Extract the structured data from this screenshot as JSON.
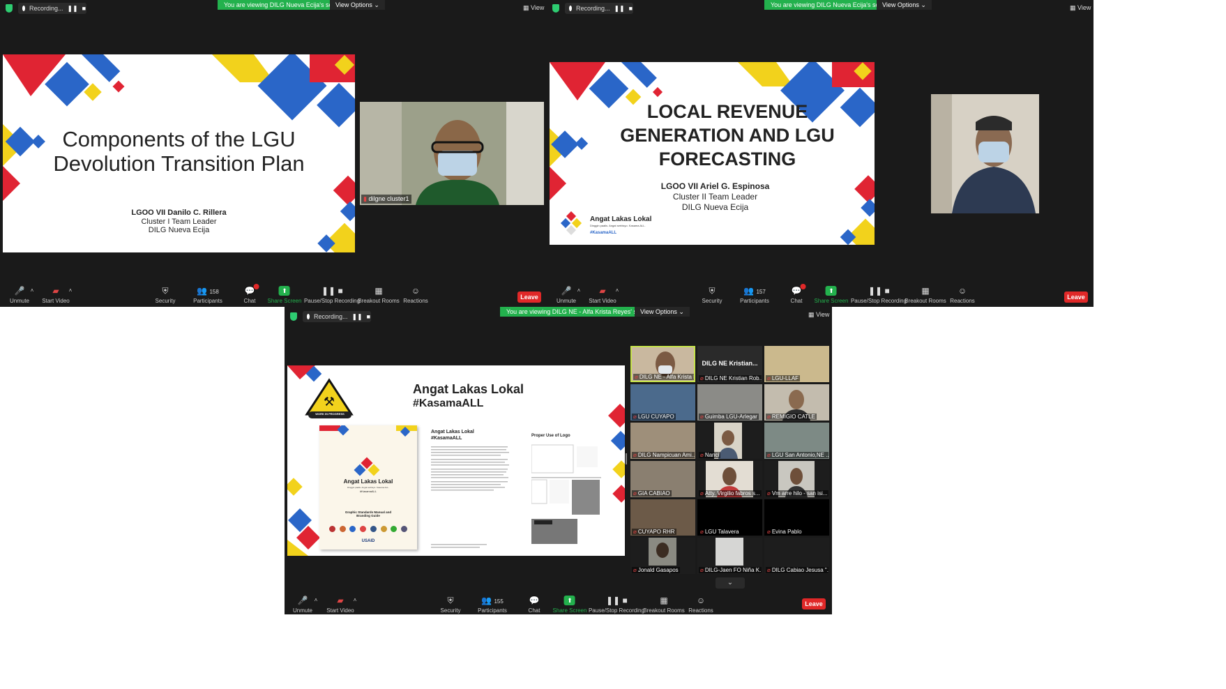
{
  "top_left": {
    "recording": "Recording...",
    "viewing": "You are viewing DILG Nueva Ecija's screen",
    "view_options": "View Options ⌄",
    "view": "View",
    "slide": {
      "title": "Components of the LGU Devolution Transition Plan",
      "presenter": "LGOO VII Danilo C. Rillera",
      "role": "Cluster I Team Leader",
      "office": "DILG Nueva Ecija"
    },
    "camera_label": "dilgne cluster1"
  },
  "top_right": {
    "recording": "Recording...",
    "viewing": "You are viewing DILG Nueva Ecija's screen",
    "view_options": "View Options ⌄",
    "view": "View",
    "slide": {
      "title": "LOCAL REVENUE GENERATION  AND LGU FORECASTING",
      "presenter": "LGOO VII Ariel G. Espinosa",
      "role": "Cluster II Team Leader",
      "office": "DILG Nueva Ecija",
      "brand": "Angat Lakas Lokal",
      "tagline": "Dinggin paalis. Angat serbisyo. Kasama ALL.",
      "hashtag": "#KasamaALL"
    }
  },
  "toolbar_left": {
    "unmute": "Unmute",
    "start_video": "Start Video",
    "security": "Security",
    "participants": "Participants",
    "participants_count": "158",
    "chat": "Chat",
    "share_screen": "Share Screen",
    "recording": "Pause/Stop Recording",
    "breakout": "Breakout Rooms",
    "reactions": "Reactions",
    "leave": "Leave"
  },
  "toolbar_right": {
    "unmute": "Unmute",
    "start_video": "Start Video",
    "security": "Security",
    "participants": "Participants",
    "participants_count": "157",
    "chat": "Chat",
    "share_screen": "Share Screen",
    "recording": "Pause/Stop Recording",
    "breakout": "Breakout Rooms",
    "reactions": "Reactions",
    "leave": "Leave"
  },
  "bottom": {
    "recording": "Recording...",
    "viewing": "You are viewing DILG NE - Alfa Krista Reyes' screen",
    "view_options": "View Options ⌄",
    "view": "View",
    "slide": {
      "brand": "Angat Lakas Lokal",
      "hashtag": "#KasamaALL",
      "wip": "WORK IN PROGRESS",
      "manual_brand": "Angat Lakas Lokal",
      "manual_tagline": "Dinggin paalis. Angat serbisyo. Kasama ALL.",
      "manual_hashtag": "#KasamaALL",
      "manual_title": "Graphic Standards Manual and Branding Guide",
      "manual_sponsor": "USAID",
      "page_title": "Angat Lakas Lokal",
      "page_hashtag": "#KasamaALL",
      "logo_heading": "Proper Use of Logo"
    },
    "tiles": [
      "DILG NE - Alfa Krista Re...",
      "DILG NE Kristian Rob...",
      "LGU-LLAF",
      "LGU CUYAPO",
      "Guimba LGU-Arlegar",
      "REMIGIO CATLE",
      "DILG Nampicuan Ami...",
      "Nanci",
      "LGU San Antonio,NE ...",
      "GIA CABIAO",
      "Atty. Virgilio fabros s...",
      "Vm arre hilo - san isi...",
      "CUYAPO RHR",
      "LGU Talavera",
      "Evina Pablo",
      "Jonald Gasapos",
      "DILG-Jaen FO Niña K...",
      "DILG Cabiao Jesusa \"..."
    ],
    "tile_big_name": "DILG NE Kristian...",
    "toolbar": {
      "unmute": "Unmute",
      "start_video": "Start Video",
      "security": "Security",
      "participants": "Participants",
      "participants_count": "155",
      "chat": "Chat",
      "share_screen": "Share Screen",
      "recording": "Pause/Stop Recording",
      "breakout": "Breakout Rooms",
      "reactions": "Reactions",
      "leave": "Leave"
    }
  },
  "colors": {
    "accent_green": "#23b14d",
    "leave_red": "#e02828",
    "slide_red": "#e02433",
    "slide_blue": "#2a66c8",
    "slide_yellow": "#f2d21c"
  }
}
